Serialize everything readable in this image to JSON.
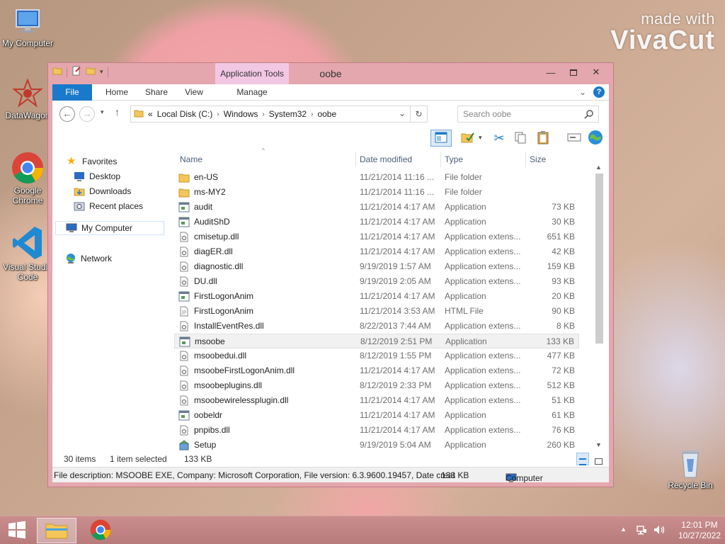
{
  "desktop": {
    "icons": [
      {
        "label": "My Computer"
      },
      {
        "label": "DataWagon"
      },
      {
        "label": "Google Chrome"
      },
      {
        "label": "Visual Studio Code"
      },
      {
        "label": "Recycle Bin"
      }
    ],
    "watermark": {
      "line1": "made with",
      "line2": "VivaCut"
    }
  },
  "window": {
    "title": "oobe",
    "context_tab": "Application Tools",
    "ribbon_tabs": [
      "File",
      "Home",
      "Share",
      "View",
      "Manage"
    ],
    "address": {
      "prefix": "«",
      "crumbs": [
        "Local Disk (C:)",
        "Windows",
        "System32",
        "oobe"
      ]
    },
    "search_placeholder": "Search oobe",
    "nav": {
      "favorites": "Favorites",
      "desktop": "Desktop",
      "downloads": "Downloads",
      "recent": "Recent places",
      "computer": "My Computer",
      "network": "Network"
    },
    "columns": {
      "name": "Name",
      "date": "Date modified",
      "type": "Type",
      "size": "Size"
    },
    "files": [
      {
        "name": "en-US",
        "date": "11/21/2014 11:16 ...",
        "type": "File folder",
        "size": "",
        "icon": "folder"
      },
      {
        "name": "ms-MY2",
        "date": "11/21/2014 11:16 ...",
        "type": "File folder",
        "size": "",
        "icon": "folder"
      },
      {
        "name": "audit",
        "date": "11/21/2014 4:17 AM",
        "type": "Application",
        "size": "73 KB",
        "icon": "app"
      },
      {
        "name": "AuditShD",
        "date": "11/21/2014 4:17 AM",
        "type": "Application",
        "size": "30 KB",
        "icon": "app"
      },
      {
        "name": "cmisetup.dll",
        "date": "11/21/2014 4:17 AM",
        "type": "Application extens...",
        "size": "651 KB",
        "icon": "dll"
      },
      {
        "name": "diagER.dll",
        "date": "11/21/2014 4:17 AM",
        "type": "Application extens...",
        "size": "42 KB",
        "icon": "dll"
      },
      {
        "name": "diagnostic.dll",
        "date": "9/19/2019 1:57 AM",
        "type": "Application extens...",
        "size": "159 KB",
        "icon": "dll"
      },
      {
        "name": "DU.dll",
        "date": "9/19/2019 2:05 AM",
        "type": "Application extens...",
        "size": "93 KB",
        "icon": "dll"
      },
      {
        "name": "FirstLogonAnim",
        "date": "11/21/2014 4:17 AM",
        "type": "Application",
        "size": "20 KB",
        "icon": "app"
      },
      {
        "name": "FirstLogonAnim",
        "date": "11/21/2014 3:53 AM",
        "type": "HTML File",
        "size": "90 KB",
        "icon": "html"
      },
      {
        "name": "InstallEventRes.dll",
        "date": "8/22/2013 7:44 AM",
        "type": "Application extens...",
        "size": "8 KB",
        "icon": "dll"
      },
      {
        "name": "msoobe",
        "date": "8/12/2019 2:51 PM",
        "type": "Application",
        "size": "133 KB",
        "icon": "app",
        "selected": true
      },
      {
        "name": "msoobedui.dll",
        "date": "8/12/2019 1:55 PM",
        "type": "Application extens...",
        "size": "477 KB",
        "icon": "dll"
      },
      {
        "name": "msoobeFirstLogonAnim.dll",
        "date": "11/21/2014 4:17 AM",
        "type": "Application extens...",
        "size": "72 KB",
        "icon": "dll"
      },
      {
        "name": "msoobeplugins.dll",
        "date": "8/12/2019 2:33 PM",
        "type": "Application extens...",
        "size": "512 KB",
        "icon": "dll"
      },
      {
        "name": "msoobewirelessplugin.dll",
        "date": "11/21/2014 4:17 AM",
        "type": "Application extens...",
        "size": "51 KB",
        "icon": "dll"
      },
      {
        "name": "oobeldr",
        "date": "11/21/2014 4:17 AM",
        "type": "Application",
        "size": "61 KB",
        "icon": "app"
      },
      {
        "name": "pnpibs.dll",
        "date": "11/21/2014 4:17 AM",
        "type": "Application extens...",
        "size": "76 KB",
        "icon": "dll"
      },
      {
        "name": "Setup",
        "date": "9/19/2019 5:04 AM",
        "type": "Application",
        "size": "260 KB",
        "icon": "setup"
      }
    ],
    "status": {
      "items": "30 items",
      "selected": "1 item selected",
      "size": "133 KB"
    },
    "infobar": {
      "description": "File description: MSOOBE EXE, Company: Microsoft Corporation, File version: 6.3.9600.19457, Date creat",
      "size": "133 KB",
      "location": "Computer"
    }
  },
  "taskbar": {
    "time": "12:01 PM",
    "date": "10/27/2022"
  },
  "colors": {
    "accent": "#1979ca",
    "window_frame": "#e4a7ad",
    "taskbar": "#c08585",
    "context_tab": "#f2c7e4"
  }
}
